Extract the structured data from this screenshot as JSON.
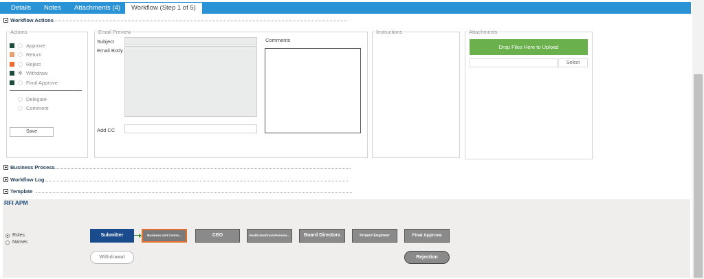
{
  "tabs": [
    "Details",
    "Notes",
    "Attachments (4)",
    "Workflow (Step 1 of 5)"
  ],
  "sections": {
    "workflow_actions": "Workflow Actions",
    "business_process": "Business Process",
    "workflow_log": "Workflow Log",
    "template": "Template"
  },
  "actions": {
    "legend": "Actions",
    "items": [
      {
        "label": "Approve",
        "color": "#1e4d3c"
      },
      {
        "label": "Return",
        "color": "#e8a070"
      },
      {
        "label": "Reject",
        "color": "#f06a2e"
      },
      {
        "label": "Withdraw",
        "color": "#1e4d3c"
      },
      {
        "label": "Final Approve",
        "color": "#1e4d3c"
      }
    ],
    "extra": [
      "Delegate",
      "Comment"
    ],
    "save": "Save"
  },
  "email": {
    "legend": "Email Preview",
    "subject": "Subject",
    "body": "Email Body",
    "addcc": "Add CC",
    "comments": "Comments"
  },
  "instructions": {
    "legend": "Instructions"
  },
  "attachments": {
    "legend": "Attachments",
    "drop": "Drop Files Here to Upload",
    "select": "Select"
  },
  "template": {
    "title": "RFI APM",
    "options": [
      "Roles",
      "Names"
    ],
    "nodes": [
      "Submitter",
      "Business Unit Contro...",
      "CEO",
      "RealEstateGrantsPermiss...",
      "Board Directors",
      "Project Engineer",
      "Final Approve"
    ],
    "withdrawal": "Withdrawal",
    "rejection": "Rejection"
  }
}
